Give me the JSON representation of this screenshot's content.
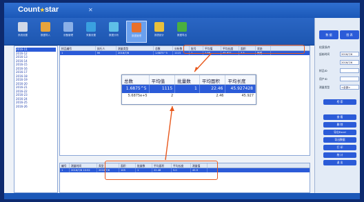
{
  "app": {
    "logo_text": "Count",
    "logo_star": "★",
    "logo_text2": "star",
    "window_close": "✕"
  },
  "toolbar": [
    {
      "label": "系统设置",
      "color": "#d0d8e8"
    },
    {
      "label": "数据导入",
      "color": "#e7a43c"
    },
    {
      "label": "设备管理",
      "color": "#8ab0e8"
    },
    {
      "label": "采集设置",
      "color": "#3aa0e0"
    },
    {
      "label": "数据分析",
      "color": "#5ec0e8"
    },
    {
      "label": "数据管理",
      "color": "#e8702c"
    },
    {
      "label": "报表统计",
      "color": "#e8c03c"
    },
    {
      "label": "数据导出",
      "color": "#4ab040"
    }
  ],
  "tree": {
    "items": [
      "2016-11",
      "2016-12",
      "2016-13",
      "2016-14",
      "2016-15",
      "2016-16",
      "2016-17",
      "2016-18",
      "2016-19",
      "2016-20",
      "2016-21",
      "2016-22",
      "2016-23",
      "2016-24",
      "2016-25",
      "2016-26"
    ]
  },
  "grid_top": {
    "headers": [
      "样品编号",
      "执行人",
      "测量类型",
      "总数",
      "分析数",
      "批号",
      "平均值",
      "平均长度",
      "面积",
      "状态"
    ],
    "row": [
      "1",
      "Mi",
      "2016/7/6",
      "1.6875^5",
      "1115",
      "1",
      "2.98",
      "45.927",
      "3.5",
      "完成"
    ]
  },
  "zoom": {
    "headers": [
      "总数",
      "平均值",
      "批量数",
      "平均面积",
      "平均长度"
    ],
    "row": [
      "1.6875^5",
      "1115",
      "1",
      "22.46",
      "45.927428"
    ],
    "row2": [
      "5.6875e+5",
      "2",
      "",
      "2.46",
      "45.927"
    ]
  },
  "grid_bottom": {
    "headers": [
      "编号",
      "测量时间",
      "类型",
      "面积",
      "批量数",
      "平均面积",
      "平均长度",
      "测量值"
    ],
    "row": [
      "1",
      "2016/7/6 10:52",
      "2016/7/6",
      "105",
      "1",
      "22.46",
      "5.0",
      "45.9"
    ]
  },
  "right_panel": {
    "tab1": "数 据",
    "tab2": "图 表",
    "group_title": "检索条件",
    "fields": [
      {
        "label": "起始时间",
        "value": "2016/7/6"
      },
      {
        "label": "",
        "value": "2016/7/6"
      },
      {
        "label": "样品ID",
        "value": ""
      },
      {
        "label": "用户ID",
        "value": ""
      },
      {
        "label": "测量类型",
        "value": "<全部>"
      }
    ],
    "search_btn": "检 索",
    "buttons": [
      "查 看",
      "删 除",
      "导出Excel",
      "导出数据",
      "打 印",
      "统 计",
      "退 出"
    ]
  },
  "colors": {
    "accent": "#2b5bd8",
    "highlight": "#e8581c",
    "frame": "#0d2a6e"
  }
}
